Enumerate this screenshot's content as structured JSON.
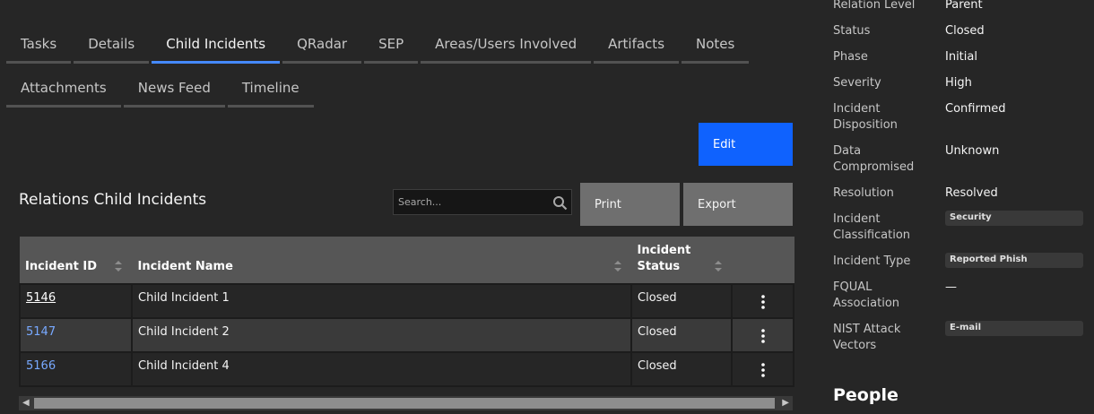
{
  "tabs_row1": [
    "Tasks",
    "Details",
    "Child Incidents",
    "QRadar",
    "SEP",
    "Areas/Users Involved",
    "Artifacts",
    "Notes"
  ],
  "tabs_row2": [
    "Attachments",
    "News Feed",
    "Timeline"
  ],
  "active_tab": "Child Incidents",
  "edit_label": "Edit",
  "section_title": "Relations Child Incidents",
  "search_placeholder": "Search...",
  "print_label": "Print",
  "export_label": "Export",
  "table": {
    "columns": [
      "Incident ID",
      "Incident Name",
      "Incident Status"
    ],
    "rows": [
      {
        "id": "5146",
        "name": "Child Incident 1",
        "status": "Closed"
      },
      {
        "id": "5147",
        "name": "Child Incident 2",
        "status": "Closed"
      },
      {
        "id": "5166",
        "name": "Child Incident 4",
        "status": "Closed"
      }
    ]
  },
  "properties": [
    {
      "label": "Relation Level",
      "value": "Parent"
    },
    {
      "label": "Status",
      "value": "Closed"
    },
    {
      "label": "Phase",
      "value": "Initial"
    },
    {
      "label": "Severity",
      "value": "High"
    },
    {
      "label": "Incident Disposition",
      "value": "Confirmed"
    },
    {
      "label": "Data Compromised",
      "value": "Unknown"
    },
    {
      "label": "Resolution",
      "value": "Resolved"
    },
    {
      "label": "Incident Classification",
      "tag": "Security"
    },
    {
      "label": "Incident Type",
      "tag": "Reported Phish"
    },
    {
      "label": "FQUAL Association",
      "value": "—"
    },
    {
      "label": "NIST Attack Vectors",
      "tag": "E-mail"
    }
  ],
  "people_title": "People",
  "colors": {
    "accent": "#0f62fe",
    "tab_active": "#4589ff",
    "link": "#78a9ff"
  }
}
